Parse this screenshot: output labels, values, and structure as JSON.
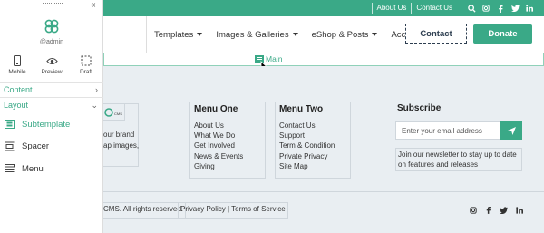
{
  "topbar": {
    "links": [
      "About Us",
      "Contact Us"
    ],
    "social_icons": [
      "search-icon",
      "instagram-icon",
      "facebook-icon",
      "twitter-icon",
      "linkedin-icon"
    ],
    "accent": "#3aa987"
  },
  "nav": {
    "menu": [
      {
        "label": "Templates"
      },
      {
        "label": "Images & Galleries"
      },
      {
        "label": "eShop & Posts"
      },
      {
        "label": "Account"
      }
    ],
    "contact_label": "Contact",
    "donate_label": "Donate"
  },
  "main_zone": {
    "label": "Main"
  },
  "footer": {
    "brand_text_lines": [
      "our brand",
      "ap images,"
    ],
    "menu_one": {
      "title": "Menu One",
      "links": [
        "About Us",
        "What We Do",
        "Get Involved",
        "News & Events",
        "Giving"
      ]
    },
    "menu_two": {
      "title": "Menu Two",
      "links": [
        "Contact Us",
        "Support",
        "Term & Condition",
        "Private Privacy",
        "Site Map"
      ]
    },
    "subscribe": {
      "title": "Subscribe",
      "placeholder": "Enter your email address",
      "note": "Join our newsletter to stay up to date on features and releases"
    },
    "copyright": "CMS. All rights reserved.",
    "policy": "Privacy Policy | Terms of Service",
    "social_icons": [
      "instagram-icon",
      "facebook-icon",
      "twitter-icon",
      "linkedin-icon"
    ]
  },
  "panel": {
    "user": "@admin",
    "modes": [
      {
        "label": "Mobile",
        "icon": "mobile-icon"
      },
      {
        "label": "Preview",
        "icon": "eye-icon"
      },
      {
        "label": "Draft",
        "icon": "draft-icon"
      }
    ],
    "sections": {
      "content": "Content",
      "layout": "Layout"
    },
    "items": [
      {
        "label": "Subtemplate",
        "icon": "subtemplate-icon",
        "active": true
      },
      {
        "label": "Spacer",
        "icon": "spacer-icon",
        "active": false
      },
      {
        "label": "Menu",
        "icon": "menu-icon",
        "active": false
      }
    ]
  }
}
